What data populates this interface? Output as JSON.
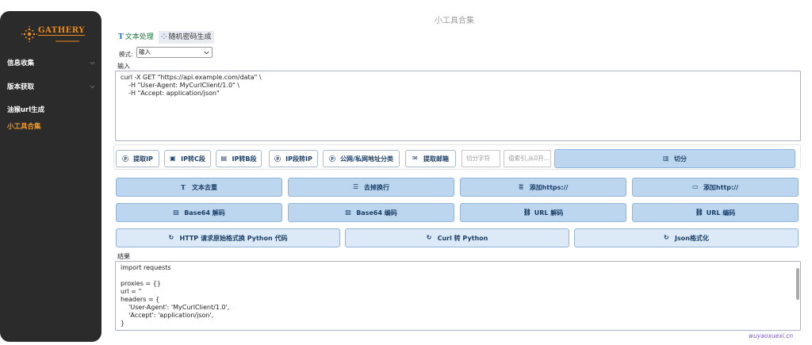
{
  "sidebar": {
    "logo_text": "GATHERY",
    "items": [
      {
        "label": "信息收集",
        "has_chevron": true,
        "active": false
      },
      {
        "label": "版本获取",
        "has_chevron": true,
        "active": false
      },
      {
        "label": "油猴url生成",
        "has_chevron": false,
        "active": false
      },
      {
        "label": "小工具合集",
        "has_chevron": false,
        "active": true
      }
    ]
  },
  "header": {
    "title": "小工具合集"
  },
  "tabs": [
    {
      "icon": "T",
      "label": "文本处理",
      "active": true
    },
    {
      "icon": "⁘",
      "label": "随机密码生成",
      "active": false
    }
  ],
  "mode": {
    "label": "模式:",
    "value": "输入"
  },
  "input": {
    "label": "输入",
    "value": "curl -X GET \"https://api.example.com/data\" \\\n    -H \"User-Agent: MyCurlClient/1.0\" \\\n    -H \"Accept: application/json\""
  },
  "toolbar": {
    "buttons": [
      {
        "icon": "ⓟ",
        "label": "提取IP"
      },
      {
        "icon": "▣",
        "label": "IP转C段"
      },
      {
        "icon": "▤",
        "label": "IP转B段"
      },
      {
        "icon": "ⓟ",
        "label": "IP段转IP"
      },
      {
        "icon": "ⓟ",
        "label": "公网/私网地址分类"
      },
      {
        "icon": "✉",
        "label": "提取邮箱"
      }
    ],
    "split_char_placeholder": "切分字符",
    "index_placeholder": "值索引,从0开...",
    "split_button": {
      "icon": "▥",
      "label": "切分"
    }
  },
  "row2": [
    {
      "icon": "T",
      "label": "文本去重"
    },
    {
      "icon": "☰",
      "label": "去掉换行"
    },
    {
      "icon": "≣",
      "label": "添加https://"
    },
    {
      "icon": "▭",
      "label": "添加http://"
    }
  ],
  "row3": [
    {
      "icon": "▨",
      "label": "Base64 解码"
    },
    {
      "icon": "▨",
      "label": "Base64 编码"
    },
    {
      "icon": "⛓",
      "label": "URL 解码"
    },
    {
      "icon": "⛓",
      "label": "URL 编码"
    }
  ],
  "row4": [
    {
      "icon": "↻",
      "label": "HTTP 请求原始格式换 Python 代码"
    },
    {
      "icon": "↻",
      "label": "Curl 转 Python"
    },
    {
      "icon": "↻",
      "label": "Json格式化"
    }
  ],
  "result": {
    "label": "结果",
    "value": "import requests\n\nproxies = {}\nurl = ''\nheaders = {\n    'User-Agent': 'MyCurlClient/1.0',\n    'Accept': 'application/json',\n}"
  },
  "watermark": "wuyaoxuexi.cn",
  "colors": {
    "accent": "#f39a2a",
    "button": "#bcd6ef",
    "sidebar": "#2b2b2b"
  }
}
